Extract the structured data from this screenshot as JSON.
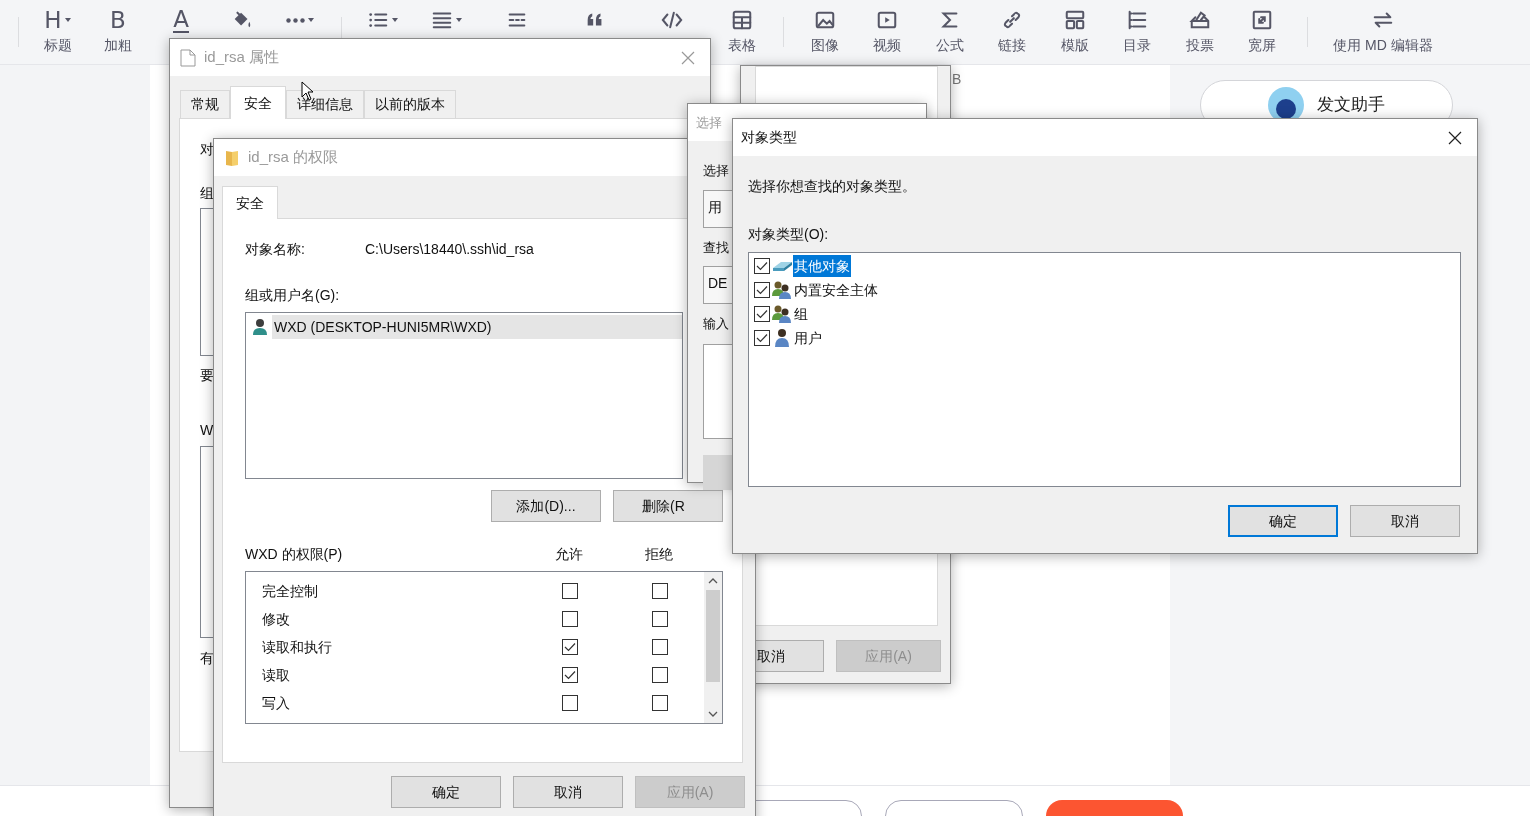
{
  "toolbar": {
    "items": [
      {
        "glyph": "H",
        "label": "标题",
        "has_menu": true
      },
      {
        "glyph": "B",
        "label": "加粗",
        "has_menu": false
      },
      {
        "glyph": "A",
        "has_menu": false
      },
      {
        "has_menu": false
      },
      {
        "has_menu": true
      },
      {
        "has_menu": true
      },
      {
        "has_menu": true
      },
      {
        "has_menu": false
      },
      {
        "has_menu": false
      },
      {
        "has_menu": false
      },
      {
        "label": "表格",
        "has_menu": false
      },
      {
        "label": "图像",
        "has_menu": false
      },
      {
        "label": "视频",
        "has_menu": false
      },
      {
        "label": "公式",
        "has_menu": false
      },
      {
        "label": "链接",
        "has_menu": false
      },
      {
        "label": "模版",
        "has_menu": false
      },
      {
        "label": "目录",
        "has_menu": false
      },
      {
        "label": "投票",
        "has_menu": false
      },
      {
        "label": "宽屏",
        "has_menu": false
      },
      {
        "label": "使用 MD 编辑器",
        "has_menu": false
      }
    ]
  },
  "editor": {
    "text": "B"
  },
  "assistant_button": {
    "label": "发文助手"
  },
  "bottom_bar": {
    "buttons": [
      {
        "kind": "outline"
      },
      {
        "kind": "outline"
      },
      {
        "kind": "primary"
      }
    ]
  },
  "properties_window": {
    "title": "id_rsa 属性",
    "active": false,
    "tabs": [
      {
        "label": "常规",
        "selected": false
      },
      {
        "label": "安全",
        "selected": true
      },
      {
        "label": "详细信息",
        "selected": false
      },
      {
        "label": "以前的版本",
        "selected": false
      }
    ],
    "cut_labels": [
      "对",
      "组",
      "要",
      "W",
      "有"
    ]
  },
  "back_window": {
    "buttons": [
      {
        "label": "取消",
        "disabled": false
      },
      {
        "label": "应用(A)",
        "disabled": true
      }
    ]
  },
  "permissions_window": {
    "title": "id_rsa 的权限",
    "active": false,
    "tabs": [
      {
        "label": "安全",
        "selected": true
      }
    ],
    "object_name_label": "对象名称:",
    "object_name": "C:\\Users\\18440\\.ssh\\id_rsa",
    "users_label": "组或用户名(G):",
    "users": [
      {
        "name": "WXD (DESKTOP-HUNI5MR\\WXD)",
        "selected": true
      }
    ],
    "add_button": "添加(D)...",
    "remove_button": "删除(R",
    "permissions_label": "WXD 的权限(P)",
    "allow_header": "允许",
    "deny_header": "拒绝",
    "permissions": [
      {
        "name": "完全控制",
        "allow": false,
        "deny": false
      },
      {
        "name": "修改",
        "allow": false,
        "deny": false
      },
      {
        "name": "读取和执行",
        "allow": true,
        "deny": false
      },
      {
        "name": "读取",
        "allow": true,
        "deny": false
      },
      {
        "name": "写入",
        "allow": false,
        "deny": false
      }
    ],
    "buttons": [
      {
        "label": "确定",
        "disabled": false
      },
      {
        "label": "取消",
        "disabled": false
      },
      {
        "label": "应用(A)",
        "disabled": true
      }
    ]
  },
  "select_window": {
    "title": "选择",
    "active": false,
    "fields": [
      {
        "label": "选择",
        "value": "用"
      },
      {
        "label": "查找",
        "value": "DE"
      }
    ],
    "input_label": "输入"
  },
  "object_types_window": {
    "title": "对象类型",
    "active": true,
    "prompt": "选择你想查找的对象类型。",
    "list_label": "对象类型(O):",
    "items": [
      {
        "kind": "other",
        "label": "其他对象",
        "checked": true,
        "selected": true
      },
      {
        "kind": "principals",
        "label": "内置安全主体",
        "checked": true,
        "selected": false
      },
      {
        "kind": "group",
        "label": "组",
        "checked": true,
        "selected": false
      },
      {
        "kind": "user",
        "label": "用户",
        "checked": true,
        "selected": false
      }
    ],
    "buttons": [
      {
        "label": "确定",
        "default": true
      },
      {
        "label": "取消",
        "default": false
      }
    ]
  }
}
